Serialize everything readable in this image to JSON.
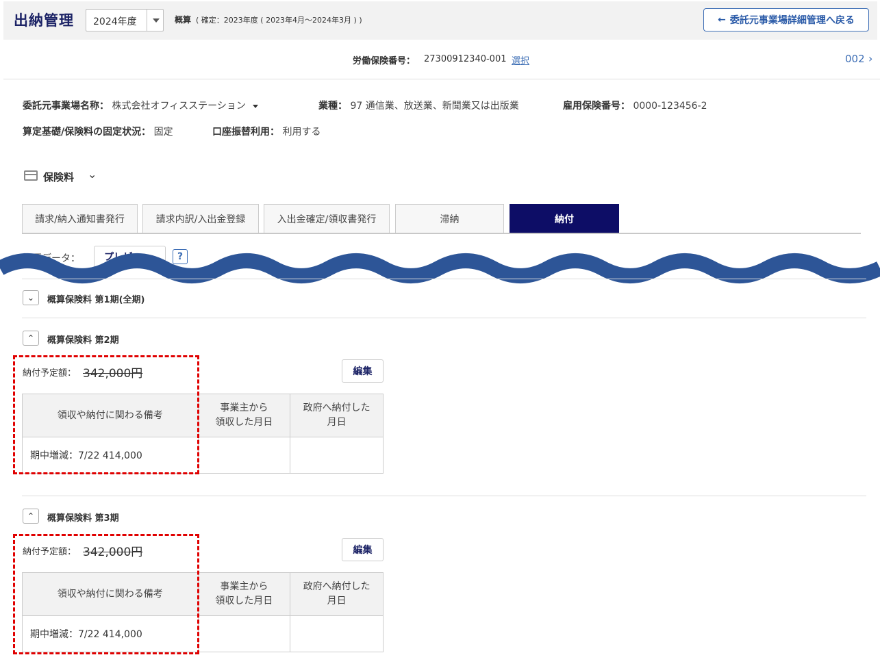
{
  "header": {
    "title": "出納管理",
    "year_select": "2024年度",
    "calc_label": "概算",
    "calc_detail": "( 確定：2023年度 ( 2023年4月～2024年3月 ) )",
    "back_button": "委託元事業場詳細管理へ戻る"
  },
  "insurance": {
    "label": "労働保険番号：",
    "value": "27300912340-001",
    "select_link": "選択",
    "page_no": "002"
  },
  "info": {
    "client_label": "委託元事業場名称：",
    "client_value": "株式会社オフィスステーション",
    "industry_label": "業種：",
    "industry_value": "97 通信業、放送業、新聞業又は出版業",
    "employment_label": "雇用保険番号：",
    "employment_value": "0000-123456-2",
    "fixed_label": "算定基礎/保険料の固定状況：",
    "fixed_value": "固定",
    "transfer_label": "口座振替利用：",
    "transfer_value": "利用する"
  },
  "section": {
    "title": "保険料"
  },
  "tabs": [
    {
      "label": "請求/納入通知書発行",
      "active": false
    },
    {
      "label": "請求内訳/入出金登録",
      "active": false
    },
    {
      "label": "入出金確定/領収書発行",
      "active": false
    },
    {
      "label": "滞納",
      "active": false
    },
    {
      "label": "納付",
      "active": true
    }
  ],
  "report": {
    "label": "帳票データ：",
    "preview_button": "プレビュー",
    "help": "?"
  },
  "periods": [
    {
      "title": "概算保険料 第1期(全期)",
      "expanded": false
    },
    {
      "title": "概算保険料 第2期",
      "expanded": true,
      "amount_label": "納付予定額：",
      "amount_value": "342,000円",
      "edit_button": "編集",
      "col1": "領収や納付に関わる備考",
      "col2_line1": "事業主から",
      "col2_line2": "領収した月日",
      "col3_line1": "政府へ納付した",
      "col3_line2": "月日",
      "note": "期中増減：7/22 414,000"
    },
    {
      "title": "概算保険料 第3期",
      "expanded": true,
      "amount_label": "納付予定額：",
      "amount_value": "342,000円",
      "edit_button": "編集",
      "col1": "領収や納付に関わる備考",
      "col2_line1": "事業主から",
      "col2_line2": "領収した月日",
      "col3_line1": "政府へ納付した",
      "col3_line2": "月日",
      "note": "期中増減：7/22 414,000"
    }
  ],
  "colors": {
    "brand_navy": "#1c2366",
    "tab_active": "#0d0d66",
    "link_blue": "#3d6eb5",
    "wave": "#2d5597",
    "highlight_red": "#e00000"
  }
}
